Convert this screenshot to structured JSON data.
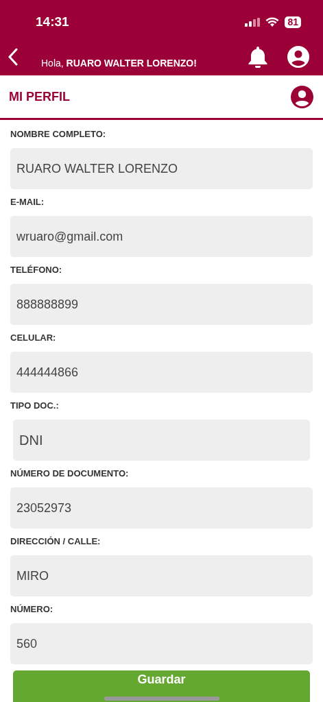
{
  "status_bar": {
    "time": "14:31",
    "battery": "81"
  },
  "app_bar": {
    "greeting": "Hola, **RUARO WALTER LORENZO!**"
  },
  "page_title": "MI PERFIL",
  "fields": [
    {
      "kind": "text",
      "label": "NOMBRE COMPLETO:",
      "value": "RUARO WALTER LORENZO"
    },
    {
      "kind": "text",
      "label": "E-MAIL:",
      "value": "wruaro@gmail.com"
    },
    {
      "kind": "text",
      "label": "TELÉFONO:",
      "value": "888888899"
    },
    {
      "kind": "text",
      "label": "CELULAR:",
      "value": "444444866"
    },
    {
      "kind": "select",
      "label": "TIPO DOC.:",
      "value": "DNI"
    },
    {
      "kind": "text",
      "label": "NÚMERO DE DOCUMENTO:",
      "value": "23052973"
    },
    {
      "kind": "text",
      "label": "DIRECCIÓN / CALLE:",
      "value": "MIRO"
    },
    {
      "kind": "text",
      "label": "NÚMERO:",
      "value": "560"
    }
  ],
  "save_button": "Guardar"
}
